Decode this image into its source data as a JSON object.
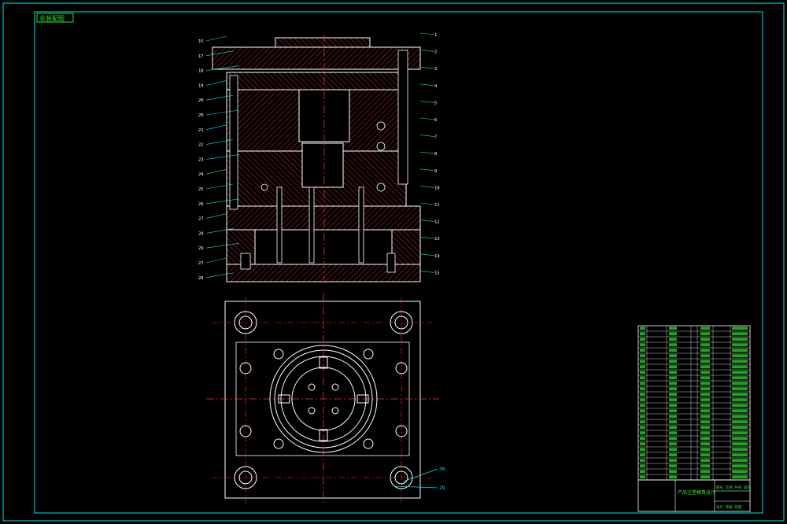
{
  "colors": {
    "background": "#000000",
    "frame": "#00e5e5",
    "outline": "#ffffff",
    "centerline": "#ff2a2a",
    "hatch": "#ff3b3b",
    "leader": "#00e5e5",
    "table_text": "#2ee82e",
    "balloon": "#2ee82e"
  },
  "stamp": {
    "label": "总装配图"
  },
  "left_labels": [
    "15",
    "17",
    "18",
    "19",
    "20",
    "20",
    "21",
    "22",
    "23",
    "24",
    "25",
    "26",
    "27",
    "28",
    "29",
    "27",
    "28"
  ],
  "right_labels": [
    "1",
    "2",
    "3",
    "4",
    "5",
    "6",
    "7",
    "8",
    "9",
    "10",
    "11",
    "12",
    "13",
    "14",
    "15"
  ],
  "plan_labels": [
    "30",
    "29"
  ],
  "parts_table": {
    "rows": 28
  },
  "title_block": {
    "title": "产品注塑模具设计",
    "row2": "图号 比例 共张 第张",
    "row3": "设计 审核 日期"
  }
}
